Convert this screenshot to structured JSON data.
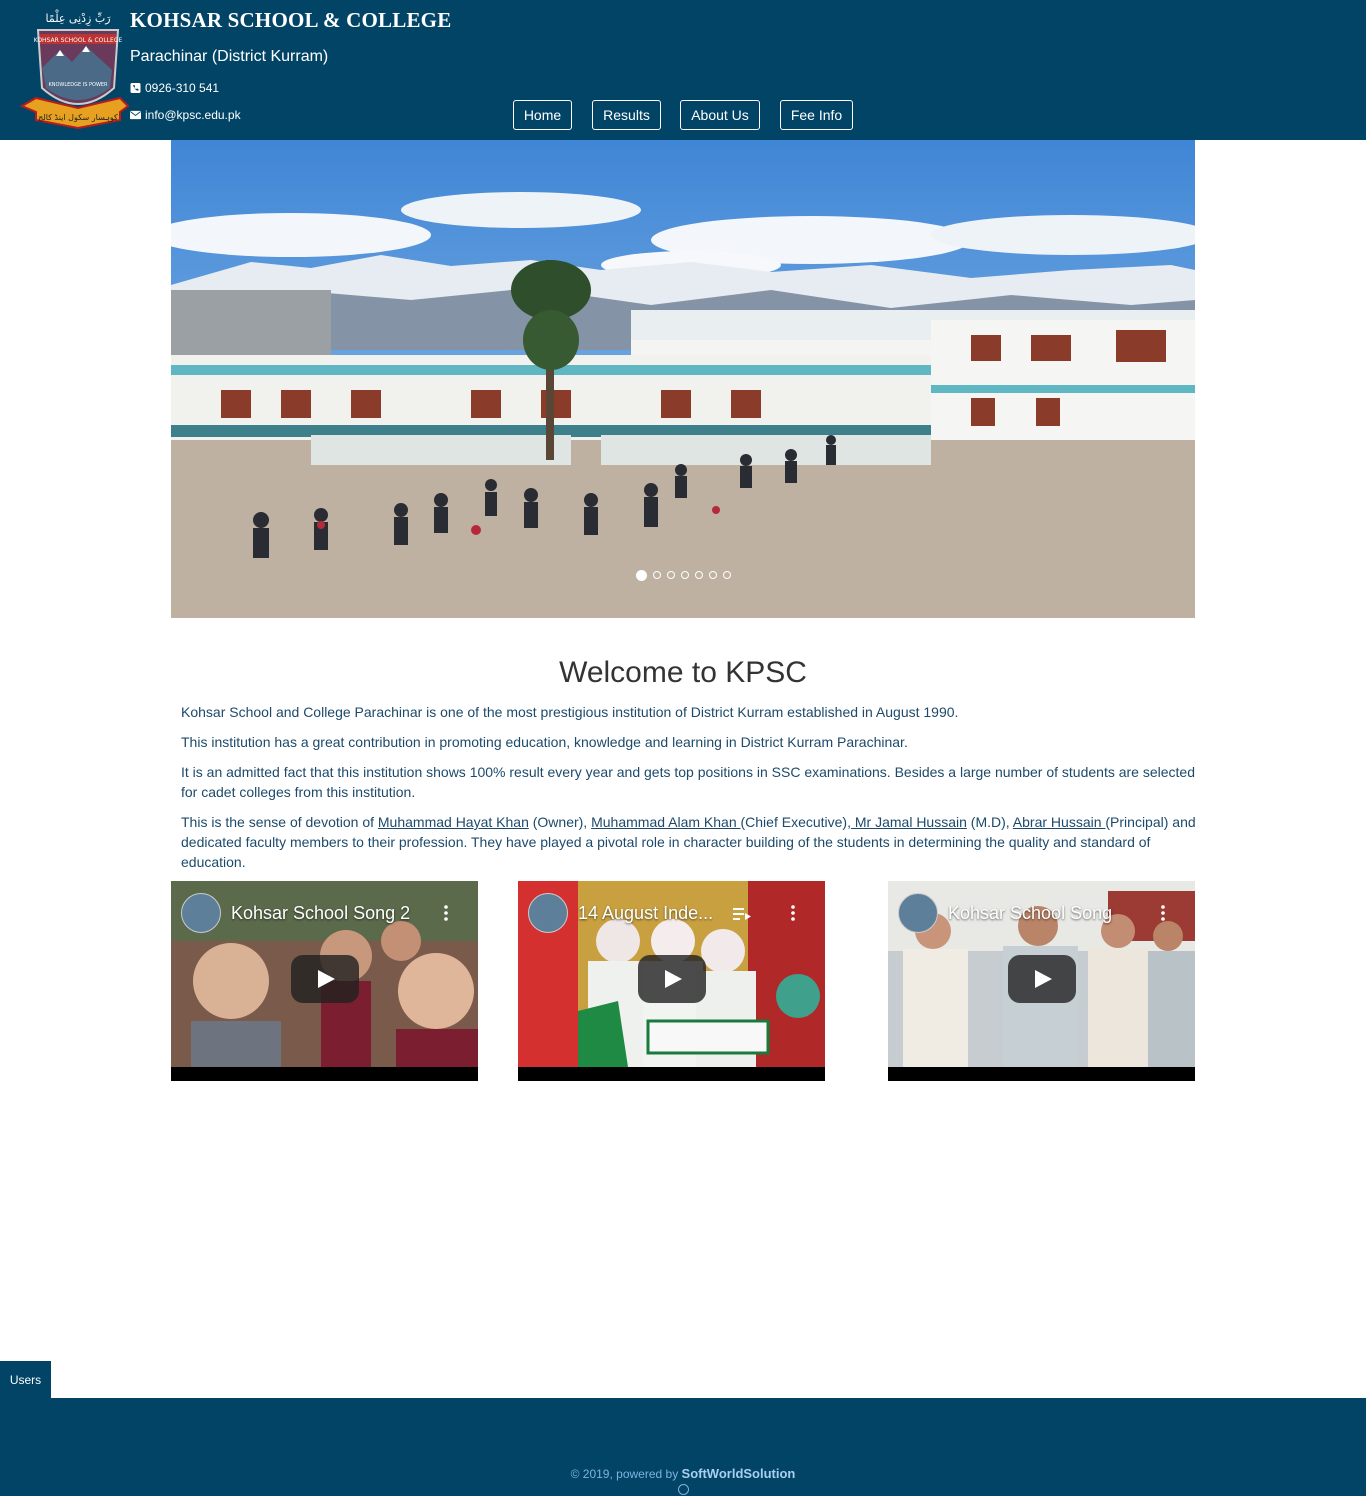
{
  "header": {
    "school_name": "KOHSAR SCHOOL & COLLEGE",
    "location": "Parachinar (District Kurram)",
    "phone": "0926-310 541",
    "email": "info@kpsc.edu.pk",
    "logo": {
      "motto_urdu": "رَبِّ زِدْنِی عِلْمًا",
      "crest_text": "KOHSAR SCHOOL & COLLEGE",
      "motto_en": "KNOWLEDGE IS POWER",
      "banner_urdu": "کوہسار سکول اینڈ کالج"
    }
  },
  "nav": {
    "items": [
      "Home",
      "Results",
      "About Us",
      "Fee Info"
    ]
  },
  "carousel": {
    "slide_count": 7,
    "active_index": 0
  },
  "welcome": {
    "title": "Welcome to KPSC",
    "p1": "Kohsar School and College Parachinar is one of the most prestigious institution of District Kurram established in August 1990.",
    "p2": "This institution has a great contribution in promoting education, knowledge and learning in District Kurram Parachinar.",
    "p3": "It is an admitted fact that this institution shows 100% result every year and gets top positions in SSC examinations. Besides a large number of students are selected for cadet colleges from this institution.",
    "p4": {
      "t1": "This is the sense of devotion of ",
      "l1": "Muhammad Hayat Khan",
      "t2": " (Owner), ",
      "l2": "Muhammad Alam Khan ",
      "t3": "(Chief Executive),",
      "l3": " Mr Jamal Hussain",
      "t4": " (M.D), ",
      "l4": "Abrar Hussain ",
      "t5": "(Principal) and dedicated faculty members to their profession. They have played a pivotal role in character building of the students in determining the quality and standard of education."
    }
  },
  "videos": [
    {
      "title": "Kohsar School Song 2"
    },
    {
      "title": "14 August Inde..."
    },
    {
      "title": "Kohsar School Song"
    }
  ],
  "users_tab": "Users",
  "footer": {
    "copyright": "© 2019, powered by ",
    "brand": "SoftWorldSolution"
  },
  "colors": {
    "primary": "#024466",
    "text": "#1d4a6b"
  }
}
